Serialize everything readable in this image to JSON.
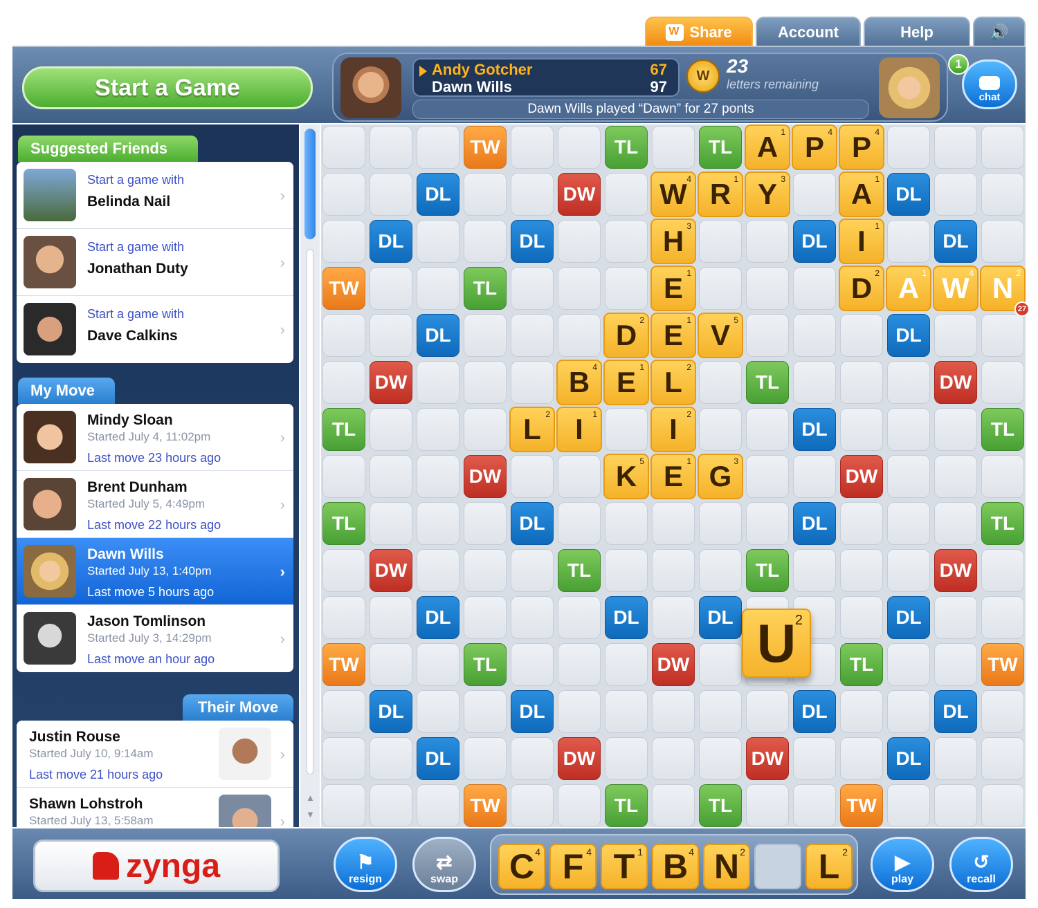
{
  "tabs": {
    "share": "Share",
    "account": "Account",
    "help": "Help",
    "sound": "🔊"
  },
  "header": {
    "start_game": "Start a Game",
    "player1": {
      "name": "Andy Gotcher",
      "score": "67",
      "color": "#ffb21a"
    },
    "player2": {
      "name": "Dawn Wills",
      "score": "97",
      "color": "#ffffff"
    },
    "bag_icon": "W",
    "letters_count": "23",
    "letters_label": "letters remaining",
    "last_play": "Dawn Wills played “Dawn” for 27 ponts",
    "chat_label": "chat",
    "chat_badge": "1"
  },
  "sidebar": {
    "suggested_label": "Suggested Friends",
    "suggested": [
      {
        "line1": "Start a game with",
        "name": "Belinda Nail"
      },
      {
        "line1": "Start a game with",
        "name": "Jonathan Duty"
      },
      {
        "line1": "Start a game with",
        "name": "Dave Calkins"
      }
    ],
    "my_move_label": "My Move",
    "my_move": [
      {
        "name": "Mindy Sloan",
        "started": "Started July 4, 11:02pm",
        "last": "Last move 23 hours ago"
      },
      {
        "name": "Brent Dunham",
        "started": "Started July 5, 4:49pm",
        "last": "Last move 22 hours ago"
      },
      {
        "name": "Dawn Wills",
        "started": "Started July 13, 1:40pm",
        "last": "Last move 5 hours ago"
      },
      {
        "name": "Jason Tomlinson",
        "started": "Started July 3, 14:29pm",
        "last": "Last move an hour ago"
      }
    ],
    "their_move_label": "Their Move",
    "their_move": [
      {
        "name": "Justin Rouse",
        "started": "Started July 10, 9:14am",
        "last": "Last move 21 hours ago"
      },
      {
        "name": "Shawn Lohstroh",
        "started": "Started July 13, 5:58am",
        "last": ""
      }
    ],
    "chevron": "›"
  },
  "board": {
    "premium_rows": [
      "...TW..TL.TL...",
      "..DL..DW.....DL..",
      "placeholder"
    ],
    "premiums": [
      [
        "",
        "",
        "",
        "TW",
        "",
        "",
        "TL",
        "",
        "TL",
        "",
        "",
        "",
        "",
        "",
        ""
      ],
      [
        "",
        "",
        "DL",
        "",
        "",
        "DW",
        "",
        "",
        "",
        "",
        "",
        "",
        "DL",
        "",
        ""
      ],
      [
        "",
        "DL",
        "",
        "",
        "DL",
        "",
        "",
        "",
        "",
        "",
        "DL",
        "",
        "",
        "DL",
        ""
      ],
      [
        "TW",
        "",
        "",
        "TL",
        "",
        "",
        "",
        "",
        "",
        "",
        "",
        "",
        "",
        "",
        ""
      ],
      [
        "",
        "",
        "DL",
        "",
        "",
        "",
        "",
        "",
        "",
        "",
        "",
        "",
        "DL",
        "",
        ""
      ],
      [
        "",
        "DW",
        "",
        "",
        "",
        "",
        "",
        "",
        "",
        "TL",
        "",
        "",
        "",
        "DW",
        ""
      ],
      [
        "TL",
        "",
        "",
        "",
        "",
        "",
        "",
        "",
        "",
        "",
        "DL",
        "",
        "",
        "",
        "TL"
      ],
      [
        "",
        "",
        "",
        "DW",
        "",
        "",
        "",
        "",
        "",
        "",
        "",
        "DW",
        "",
        "",
        ""
      ],
      [
        "TL",
        "",
        "",
        "",
        "DL",
        "",
        "",
        "",
        "",
        "",
        "DL",
        "",
        "",
        "",
        "TL"
      ],
      [
        "",
        "DW",
        "",
        "",
        "",
        "TL",
        "",
        "",
        "",
        "TL",
        "",
        "",
        "",
        "DW",
        ""
      ],
      [
        "",
        "",
        "DL",
        "",
        "",
        "",
        "DL",
        "",
        "DL",
        "",
        "",
        "",
        "DL",
        "",
        ""
      ],
      [
        "TW",
        "",
        "",
        "TL",
        "",
        "",
        "",
        "DW",
        "",
        "",
        "",
        "TL",
        "",
        "",
        "TW"
      ],
      [
        "",
        "DL",
        "",
        "",
        "DL",
        "",
        "",
        "",
        "",
        "",
        "DL",
        "",
        "",
        "DL",
        ""
      ],
      [
        "",
        "",
        "DL",
        "",
        "",
        "DW",
        "",
        "",
        "",
        "DW",
        "",
        "",
        "DL",
        "",
        ""
      ],
      [
        "",
        "",
        "",
        "TW",
        "",
        "",
        "TL",
        "",
        "TL",
        "",
        "",
        "TW",
        "",
        "",
        ""
      ]
    ],
    "tiles": [
      {
        "r": 0,
        "c": 9,
        "letter": "A",
        "pts": "1"
      },
      {
        "r": 0,
        "c": 10,
        "letter": "P",
        "pts": "4"
      },
      {
        "r": 0,
        "c": 11,
        "letter": "P",
        "pts": "4"
      },
      {
        "r": 1,
        "c": 7,
        "letter": "W",
        "pts": "4"
      },
      {
        "r": 1,
        "c": 8,
        "letter": "R",
        "pts": "1"
      },
      {
        "r": 1,
        "c": 9,
        "letter": "Y",
        "pts": "3"
      },
      {
        "r": 1,
        "c": 11,
        "letter": "A",
        "pts": "1"
      },
      {
        "r": 2,
        "c": 7,
        "letter": "H",
        "pts": "3"
      },
      {
        "r": 2,
        "c": 11,
        "letter": "I",
        "pts": "1"
      },
      {
        "r": 3,
        "c": 7,
        "letter": "E",
        "pts": "1"
      },
      {
        "r": 3,
        "c": 11,
        "letter": "D",
        "pts": "2"
      },
      {
        "r": 3,
        "c": 12,
        "letter": "A",
        "pts": "1",
        "white": true
      },
      {
        "r": 3,
        "c": 13,
        "letter": "W",
        "pts": "4",
        "white": true
      },
      {
        "r": 3,
        "c": 14,
        "letter": "N",
        "pts": "2",
        "white": true
      },
      {
        "r": 4,
        "c": 6,
        "letter": "D",
        "pts": "2"
      },
      {
        "r": 4,
        "c": 7,
        "letter": "E",
        "pts": "1"
      },
      {
        "r": 4,
        "c": 8,
        "letter": "V",
        "pts": "5"
      },
      {
        "r": 5,
        "c": 5,
        "letter": "B",
        "pts": "4"
      },
      {
        "r": 5,
        "c": 6,
        "letter": "E",
        "pts": "1"
      },
      {
        "r": 5,
        "c": 7,
        "letter": "L",
        "pts": "2"
      },
      {
        "r": 6,
        "c": 4,
        "letter": "L",
        "pts": "2"
      },
      {
        "r": 6,
        "c": 5,
        "letter": "I",
        "pts": "1"
      },
      {
        "r": 6,
        "c": 7,
        "letter": "I",
        "pts": "2"
      },
      {
        "r": 7,
        "c": 6,
        "letter": "K",
        "pts": "5"
      },
      {
        "r": 7,
        "c": 7,
        "letter": "E",
        "pts": "1"
      },
      {
        "r": 7,
        "c": 8,
        "letter": "G",
        "pts": "3"
      }
    ],
    "score_badge": "27",
    "held_tile": {
      "letter": "U",
      "pts": "2"
    }
  },
  "footer": {
    "brand": "zynga",
    "resign": "resign",
    "swap": "swap",
    "play": "play",
    "recall": "recall",
    "rack": [
      {
        "letter": "C",
        "pts": "4"
      },
      {
        "letter": "F",
        "pts": "4"
      },
      {
        "letter": "T",
        "pts": "1"
      },
      {
        "letter": "B",
        "pts": "4"
      },
      {
        "letter": "N",
        "pts": "2"
      },
      {
        "letter": "",
        "pts": ""
      },
      {
        "letter": "L",
        "pts": "2"
      }
    ]
  }
}
